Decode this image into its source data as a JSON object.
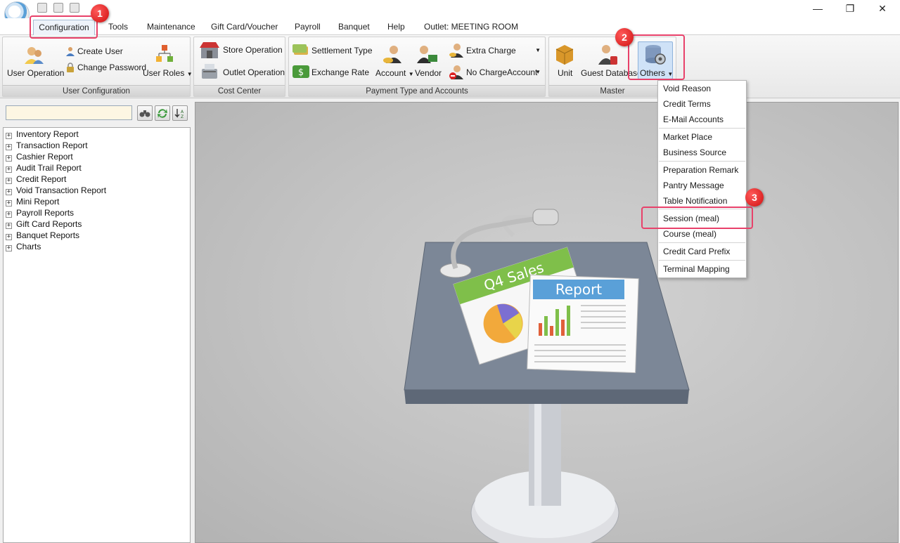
{
  "menu_tabs": [
    "Configuration",
    "Tools",
    "Maintenance",
    "Gift Card/Voucher",
    "Payroll",
    "Banquet",
    "Help",
    "Outlet: MEETING ROOM"
  ],
  "window_controls": {
    "minimize": "—",
    "restore": "❐",
    "close": "✕"
  },
  "ribbon": {
    "user_config": {
      "label": "User Configuration",
      "user_operation": "User Operation",
      "create_user": "Create User",
      "change_password": "Change Password",
      "user_roles": "User Roles"
    },
    "cost_center": {
      "label": "Cost Center",
      "store_operation": "Store Operation",
      "outlet_operation": "Outlet Operation"
    },
    "payment": {
      "label": "Payment Type and Accounts",
      "settlement_type": "Settlement Type",
      "exchange_rate": "Exchange Rate",
      "account": "Account",
      "vendor": "Vendor",
      "extra_charge": "Extra Charge",
      "no_charge_account": "No ChargeAccount"
    },
    "master": {
      "label": "Master",
      "unit": "Unit",
      "guest_database": "Guest Database",
      "others": "Others"
    }
  },
  "report_tree": [
    "Inventory Report",
    "Transaction Report",
    "Cashier Report",
    "Audit Trail Report",
    "Credit Report",
    "Void Transaction Report",
    "Mini Report",
    "Payroll Reports",
    "Gift Card Reports",
    "Banquet Reports",
    "Charts"
  ],
  "tree_toggle": "+",
  "search": {
    "value": ""
  },
  "others_menu": [
    "Void Reason",
    "Credit Terms",
    "E-Mail Accounts",
    "Market Place",
    "Business Source",
    "Preparation Remark",
    "Pantry Message",
    "Table Notification",
    "Session (meal)",
    "Course (meal)",
    "Credit Card Prefix",
    "Terminal Mapping"
  ],
  "annotations": [
    "1",
    "2",
    "3"
  ],
  "illustration": {
    "sign_text": "Q4 Sales",
    "report_title": "Report"
  },
  "colors": {
    "highlight": "#e8416a",
    "badge": "#e02020",
    "search_bg": "#fdf6e3"
  }
}
